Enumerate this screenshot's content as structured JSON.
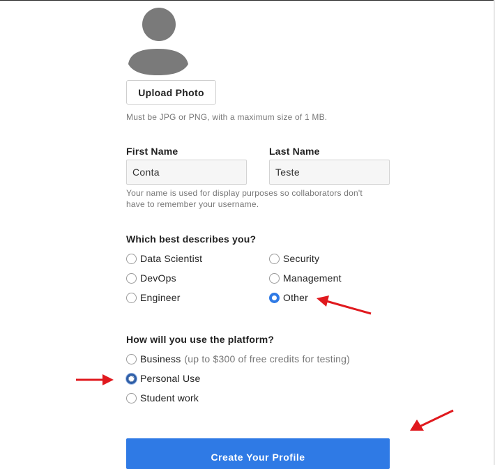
{
  "profile_photo": {
    "avatar_icon": "user-silhouette-icon",
    "upload_button_label": "Upload Photo",
    "hint": "Must be JPG or PNG, with a maximum size of 1 MB."
  },
  "name": {
    "first_label": "First Name",
    "first_value": "Conta",
    "last_label": "Last Name",
    "last_value": "Teste",
    "hint_line1": "Your name is used for display purposes so collaborators don't",
    "hint_line2": "have to remember your username."
  },
  "role": {
    "question": "Which best describes you?",
    "options": [
      {
        "label": "Data Scientist",
        "checked": false
      },
      {
        "label": "Security",
        "checked": false
      },
      {
        "label": "DevOps",
        "checked": false
      },
      {
        "label": "Management",
        "checked": false
      },
      {
        "label": "Engineer",
        "checked": false
      },
      {
        "label": "Other",
        "checked": true
      }
    ]
  },
  "usage": {
    "question": "How will you use the platform?",
    "options": [
      {
        "label": "Business",
        "note": "(up to $300 of free credits for testing)",
        "checked": false
      },
      {
        "label": "Personal Use",
        "checked": true
      },
      {
        "label": "Student work",
        "checked": false
      }
    ]
  },
  "submit_label": "Create Your Profile",
  "colors": {
    "accent": "#2f7ae5",
    "annotation_arrow": "#e0191e"
  }
}
